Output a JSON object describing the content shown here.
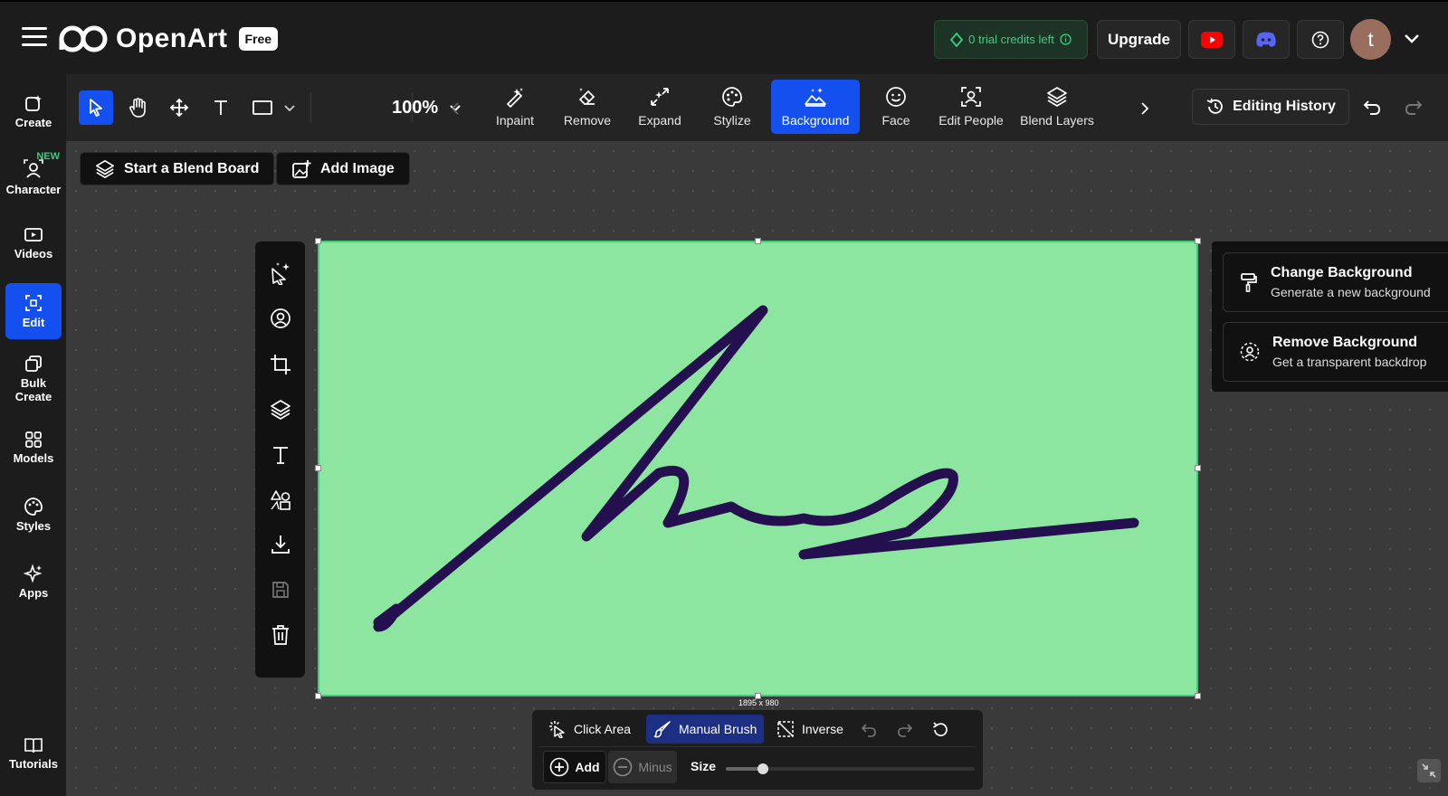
{
  "header": {
    "brand": "OpenArt",
    "plan_badge": "Free",
    "credits": "0 trial credits left",
    "upgrade": "Upgrade",
    "avatar_letter": "t"
  },
  "sidebar": {
    "items": [
      {
        "label": "Create"
      },
      {
        "label": "Character",
        "tag": "NEW"
      },
      {
        "label": "Videos"
      },
      {
        "label": "Edit",
        "active": true
      },
      {
        "label": "Bulk Create"
      },
      {
        "label": "Models"
      },
      {
        "label": "Styles"
      },
      {
        "label": "Apps"
      }
    ],
    "tutorials": "Tutorials"
  },
  "toolbar": {
    "zoom": "100%",
    "features": [
      {
        "label": "Inpaint",
        "icon": "wand-pen-icon"
      },
      {
        "label": "Remove",
        "icon": "eraser-icon"
      },
      {
        "label": "Expand",
        "icon": "expand-icon"
      },
      {
        "label": "Stylize",
        "icon": "palette-icon"
      },
      {
        "label": "Background",
        "icon": "landscape-icon",
        "active": true
      },
      {
        "label": "Face",
        "icon": "smile-icon"
      },
      {
        "label": "Edit People",
        "icon": "person-frame-icon"
      },
      {
        "label": "Blend Layers",
        "icon": "layers-icon"
      }
    ],
    "editing_history": "Editing History"
  },
  "canvas": {
    "start_blend_board": "Start a Blend Board",
    "add_image": "Add Image",
    "image_dimensions": "1895 x 980"
  },
  "background_panel": {
    "options": [
      {
        "title": "Change Background",
        "subtitle": "Generate a new background"
      },
      {
        "title": "Remove Background",
        "subtitle": "Get a transparent backdrop"
      }
    ]
  },
  "brush_panel": {
    "click_area": "Click Area",
    "manual_brush": "Manual Brush",
    "inverse": "Inverse",
    "add": "Add",
    "minus": "Minus",
    "size": "Size",
    "size_value": 0.15
  },
  "colors": {
    "accent": "#1450f0",
    "image_bg": "#8ce6a0",
    "signature": "#24104f",
    "credits_text": "#3ad07a"
  }
}
